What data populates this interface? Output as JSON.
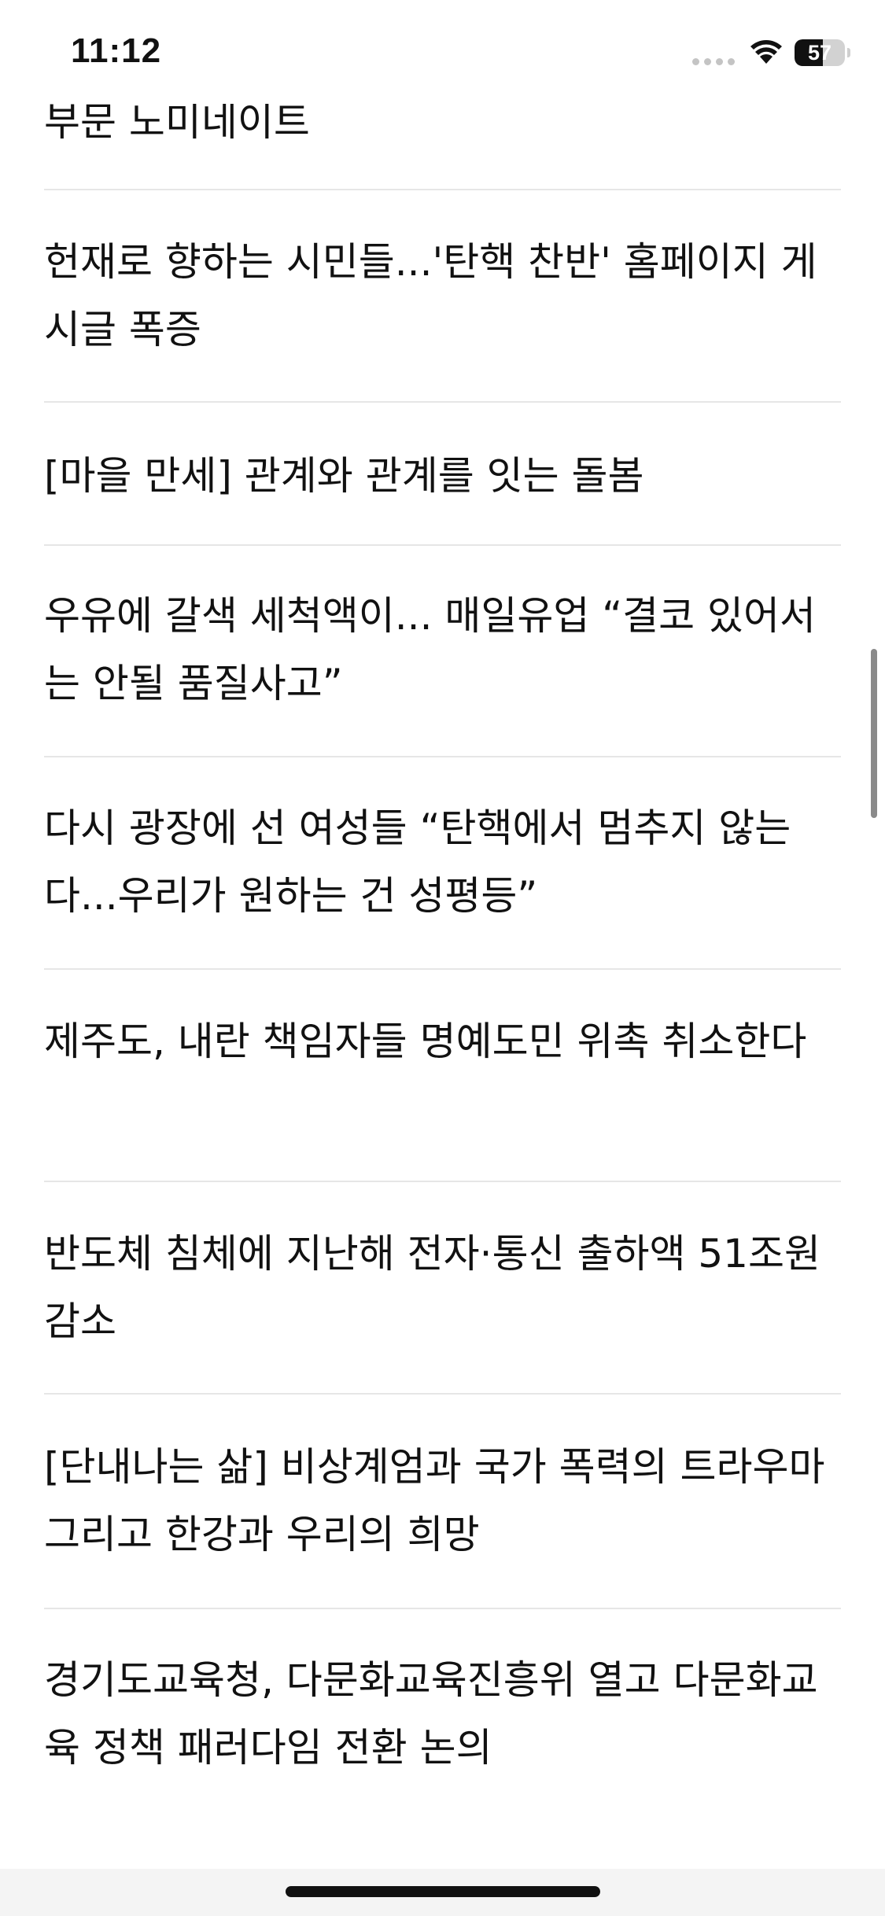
{
  "status_bar": {
    "time": "11:12",
    "battery_level": "57",
    "battery_fraction": 0.57,
    "signal_icon": "cellular-signal-icon",
    "wifi_icon": "wifi-icon"
  },
  "articles": [
    {
      "title": "부문 노미네이트"
    },
    {
      "title": "헌재로 향하는 시민들...'탄핵 찬반' 홈페이지 게시글 폭증"
    },
    {
      "title": "[마을 만세] 관계와 관계를 잇는 돌봄"
    },
    {
      "title": "우유에 갈색 세척액이... 매일유업 “결코 있어서는 안될 품질사고”"
    },
    {
      "title": "다시 광장에 선 여성들 “탄핵에서 멈추지 않는다...우리가 원하는 건 성평등”"
    },
    {
      "title": "제주도, 내란 책임자들 명예도민 위촉 취소한다"
    },
    {
      "title": "반도체 침체에 지난해 전자·통신 출하액 51조원 감소"
    },
    {
      "title": "[단내나는 삶] 비상계엄과 국가 폭력의 트라우마 그리고 한강과 우리의 희망"
    },
    {
      "title": "경기도교육청, 다문화교육진흥위 열고 다문화교육 정책 패러다임 전환 논의"
    }
  ],
  "colors": {
    "text": "#111111",
    "divider": "#e6e6e6",
    "background": "#ffffff"
  }
}
